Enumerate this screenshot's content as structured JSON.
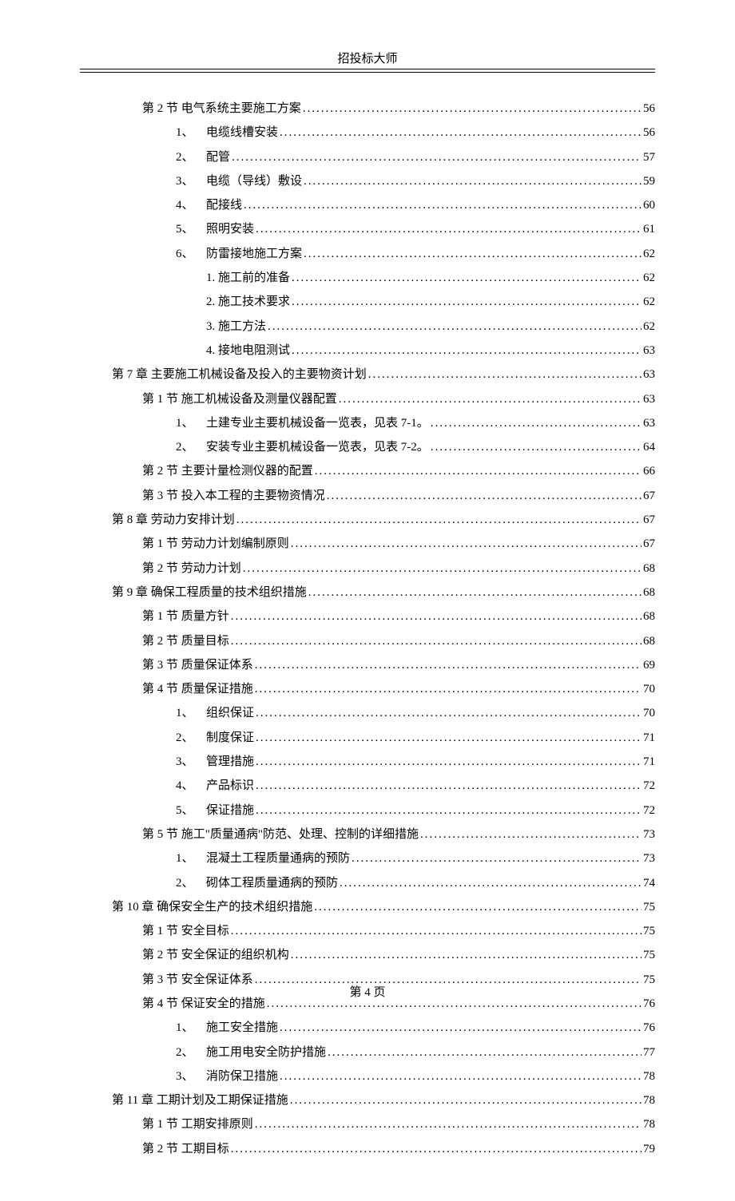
{
  "header": "招投标大师",
  "footer": "第 4 页",
  "toc": [
    {
      "level": "section",
      "label": "第 2 节  电气系统主要施工方案",
      "page": "56"
    },
    {
      "level": "item",
      "num": "1、",
      "label": "电缆线槽安装",
      "page": "56"
    },
    {
      "level": "item",
      "num": "2、",
      "label": "配管",
      "page": "57"
    },
    {
      "level": "item",
      "num": "3、",
      "label": "电缆（导线）敷设",
      "page": "59"
    },
    {
      "level": "item",
      "num": "4、",
      "label": "配接线",
      "page": "60"
    },
    {
      "level": "item",
      "num": "5、",
      "label": "照明安装",
      "page": "61"
    },
    {
      "level": "item",
      "num": "6、",
      "label": "防雷接地施工方案",
      "page": "62"
    },
    {
      "level": "subitem",
      "label": "1. 施工前的准备",
      "page": "62"
    },
    {
      "level": "subitem",
      "label": "2. 施工技术要求",
      "page": "62"
    },
    {
      "level": "subitem",
      "label": "3. 施工方法",
      "page": "62"
    },
    {
      "level": "subitem",
      "label": "4. 接地电阻测试",
      "page": "63"
    },
    {
      "level": "chapter",
      "label": "第 7 章  主要施工机械设备及投入的主要物资计划",
      "page": "63"
    },
    {
      "level": "section",
      "label": "第 1 节  施工机械设备及测量仪器配置",
      "page": "63"
    },
    {
      "level": "item",
      "num": "1、",
      "label": "土建专业主要机械设备一览表，见表 7-1。",
      "page": "63"
    },
    {
      "level": "item",
      "num": "2、",
      "label": "安装专业主要机械设备一览表，见表 7-2。",
      "page": "64"
    },
    {
      "level": "section",
      "label": "第 2 节  主要计量检测仪器的配置",
      "page": "66"
    },
    {
      "level": "section",
      "label": "第 3 节  投入本工程的主要物资情况",
      "page": "67"
    },
    {
      "level": "chapter",
      "label": "第 8 章  劳动力安排计划",
      "page": "67"
    },
    {
      "level": "section",
      "label": "第 1 节  劳动力计划编制原则",
      "page": "67"
    },
    {
      "level": "section",
      "label": "第 2 节  劳动力计划",
      "page": "68"
    },
    {
      "level": "chapter",
      "label": "第 9 章  确保工程质量的技术组织措施",
      "page": "68"
    },
    {
      "level": "section",
      "label": "第 1 节  质量方针",
      "page": "68"
    },
    {
      "level": "section",
      "label": "第 2 节  质量目标",
      "page": "68"
    },
    {
      "level": "section",
      "label": "第 3 节  质量保证体系",
      "page": "69"
    },
    {
      "level": "section",
      "label": "第 4 节  质量保证措施",
      "page": "70"
    },
    {
      "level": "item",
      "num": "1、",
      "label": "组织保证",
      "page": "70"
    },
    {
      "level": "item",
      "num": "2、",
      "label": "制度保证",
      "page": "71"
    },
    {
      "level": "item",
      "num": "3、",
      "label": "管理措施",
      "page": "71"
    },
    {
      "level": "item",
      "num": "4、",
      "label": "产品标识",
      "page": "72"
    },
    {
      "level": "item",
      "num": "5、",
      "label": "保证措施",
      "page": "72"
    },
    {
      "level": "section",
      "label": "第 5 节  施工\"质量通病\"防范、处理、控制的详细措施",
      "page": "73"
    },
    {
      "level": "item",
      "num": "1、",
      "label": "混凝土工程质量通病的预防",
      "page": "73"
    },
    {
      "level": "item",
      "num": "2、",
      "label": "砌体工程质量通病的预防",
      "page": "74"
    },
    {
      "level": "chapter",
      "label": "第 10 章  确保安全生产的技术组织措施",
      "page": "75"
    },
    {
      "level": "section",
      "label": "第 1 节  安全目标",
      "page": "75"
    },
    {
      "level": "section",
      "label": "第 2 节  安全保证的组织机构",
      "page": "75"
    },
    {
      "level": "section",
      "label": "第 3 节  安全保证体系",
      "page": "75"
    },
    {
      "level": "section",
      "label": "第 4 节  保证安全的措施",
      "page": "76"
    },
    {
      "level": "item",
      "num": "1、",
      "label": "施工安全措施",
      "page": "76"
    },
    {
      "level": "item",
      "num": "2、",
      "label": "施工用电安全防护措施",
      "page": "77"
    },
    {
      "level": "item",
      "num": "3、",
      "label": "消防保卫措施",
      "page": "78"
    },
    {
      "level": "chapter",
      "label": "第 11 章  工期计划及工期保证措施",
      "page": "78"
    },
    {
      "level": "section",
      "label": "第 1 节  工期安排原则",
      "page": "78"
    },
    {
      "level": "section",
      "label": "第 2 节  工期目标",
      "page": "79"
    }
  ]
}
